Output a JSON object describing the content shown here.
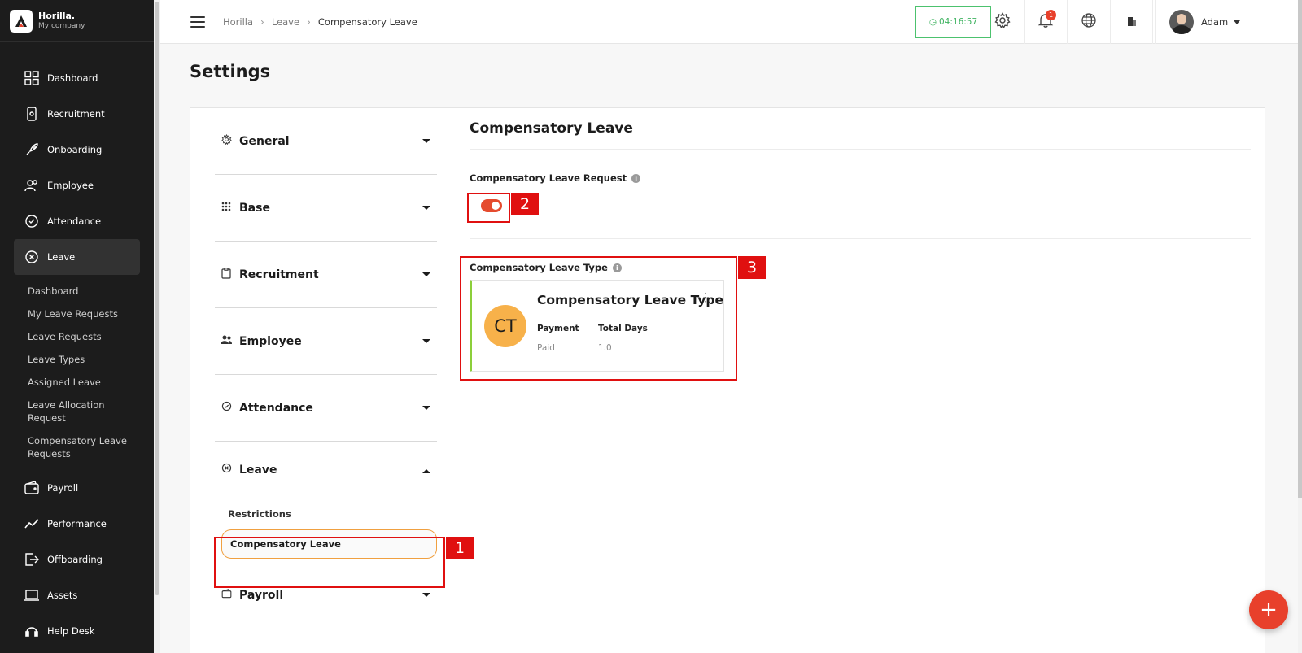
{
  "brand": {
    "name": "Horilla.",
    "company": "My company"
  },
  "sidebar": {
    "items": [
      {
        "label": "Dashboard",
        "icon": "dashboard-icon"
      },
      {
        "label": "Recruitment",
        "icon": "recruitment-icon"
      },
      {
        "label": "Onboarding",
        "icon": "rocket-icon"
      },
      {
        "label": "Employee",
        "icon": "people-icon"
      },
      {
        "label": "Attendance",
        "icon": "check-circle-icon"
      },
      {
        "label": "Leave",
        "icon": "x-circle-icon",
        "active": true
      }
    ],
    "leave_submenu": [
      "Dashboard",
      "My Leave Requests",
      "Leave Requests",
      "Leave Types",
      "Assigned Leave",
      "Leave Allocation Request",
      "Compensatory Leave Requests"
    ],
    "items_after": [
      {
        "label": "Payroll",
        "icon": "wallet-icon"
      },
      {
        "label": "Performance",
        "icon": "trend-icon"
      },
      {
        "label": "Offboarding",
        "icon": "exit-icon"
      },
      {
        "label": "Assets",
        "icon": "laptop-icon"
      },
      {
        "label": "Help Desk",
        "icon": "headset-icon"
      }
    ]
  },
  "header": {
    "breadcrumb": [
      "Horilla",
      "Leave",
      "Compensatory Leave"
    ],
    "timer": "04:16:57",
    "notification_count": "1",
    "user_name": "Adam"
  },
  "page": {
    "title": "Settings"
  },
  "settings_nav": {
    "sections": [
      "General",
      "Base",
      "Recruitment",
      "Employee",
      "Attendance",
      "Leave"
    ],
    "leave_links": [
      "Restrictions",
      "Compensatory Leave"
    ],
    "last_section": "Payroll"
  },
  "content": {
    "title": "Compensatory Leave",
    "request_label": "Compensatory Leave Request",
    "request_enabled": true,
    "type_label": "Compensatory Leave Type",
    "card": {
      "initials": "CT",
      "title": "Compensatory Leave Type",
      "payment_label": "Payment",
      "payment_value": "Paid",
      "days_label": "Total Days",
      "days_value": "1.0"
    }
  },
  "annotations": [
    "1",
    "2",
    "3"
  ],
  "colors": {
    "accent": "#e8402b",
    "timer": "#3db25f",
    "avatar_bg": "#f7b14a",
    "card_border": "#8ccf3a",
    "annotation": "#e01010"
  }
}
